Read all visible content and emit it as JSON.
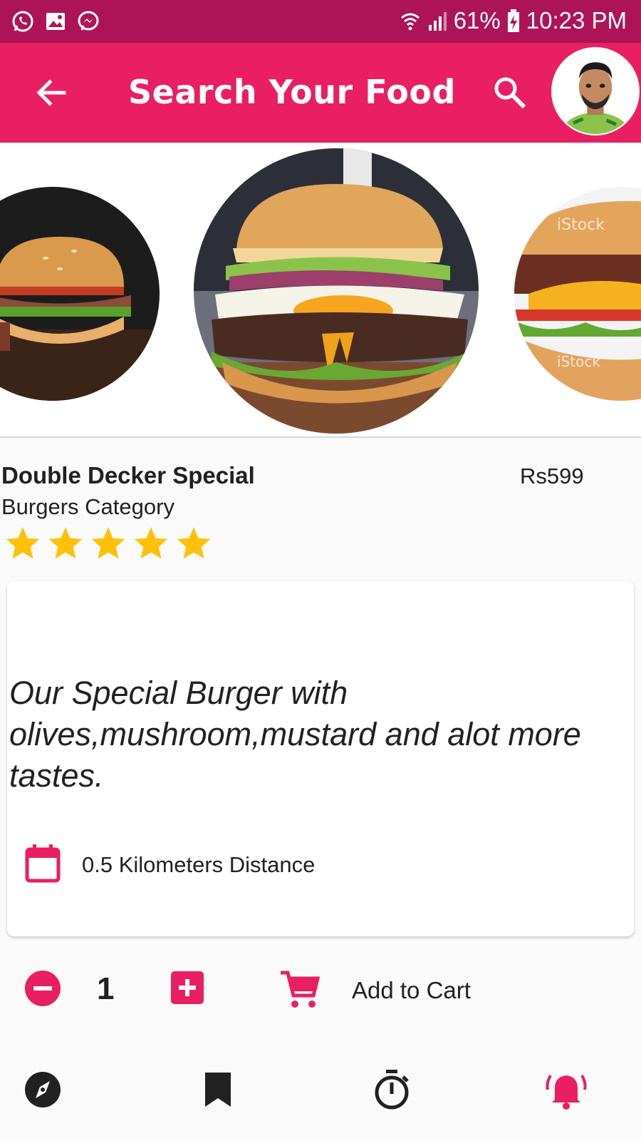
{
  "status_bar": {
    "battery_percent": "61%",
    "time": "10:23 PM",
    "icons": [
      "whatsapp-icon",
      "gallery-icon",
      "messenger-icon",
      "wifi-icon",
      "signal-icon",
      "battery-charging-icon"
    ]
  },
  "app_bar": {
    "title": "Search Your Food",
    "back_icon": "arrow-back-icon",
    "search_icon": "search-icon"
  },
  "product": {
    "name": "Double Decker Special",
    "price": "Rs599",
    "category": "Burgers Category",
    "rating": 5,
    "rating_max": 5,
    "description": "Our Special Burger with olives,mushroom,mustard and alot more tastes.",
    "distance": "0.5 Kilometers Distance"
  },
  "quantity": {
    "value": "1"
  },
  "cart": {
    "label": "Add to Cart"
  },
  "bottom_nav": {
    "items": [
      "explore-icon",
      "bookmark-icon",
      "timer-icon",
      "alarm-icon"
    ],
    "active": "alarm-icon"
  },
  "colors": {
    "primary": "#e91e63",
    "status_bar": "#ad1457",
    "star": "#ffc107",
    "text": "#212121"
  }
}
